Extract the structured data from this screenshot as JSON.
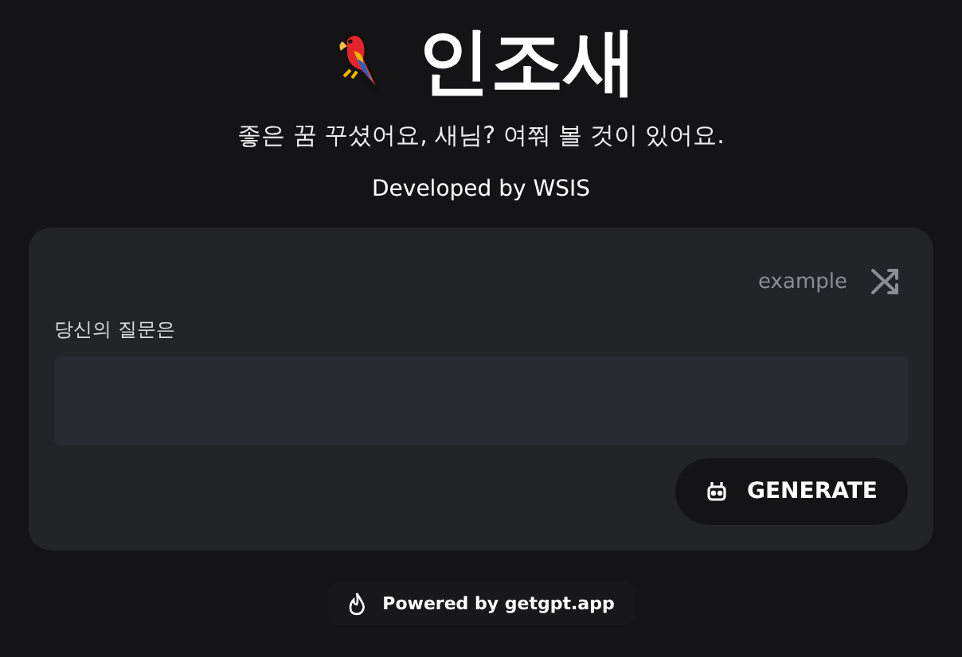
{
  "title": "인조새",
  "subtitle": "좋은 꿈 꾸셨어요, 새님? 여쭤 볼 것이 있어요.",
  "developer": "Developed by WSIS",
  "form": {
    "example_label": "example",
    "question_label": "당신의 질문은",
    "generate_button": "GENERATE"
  },
  "footer": "Powered by getgpt.app"
}
